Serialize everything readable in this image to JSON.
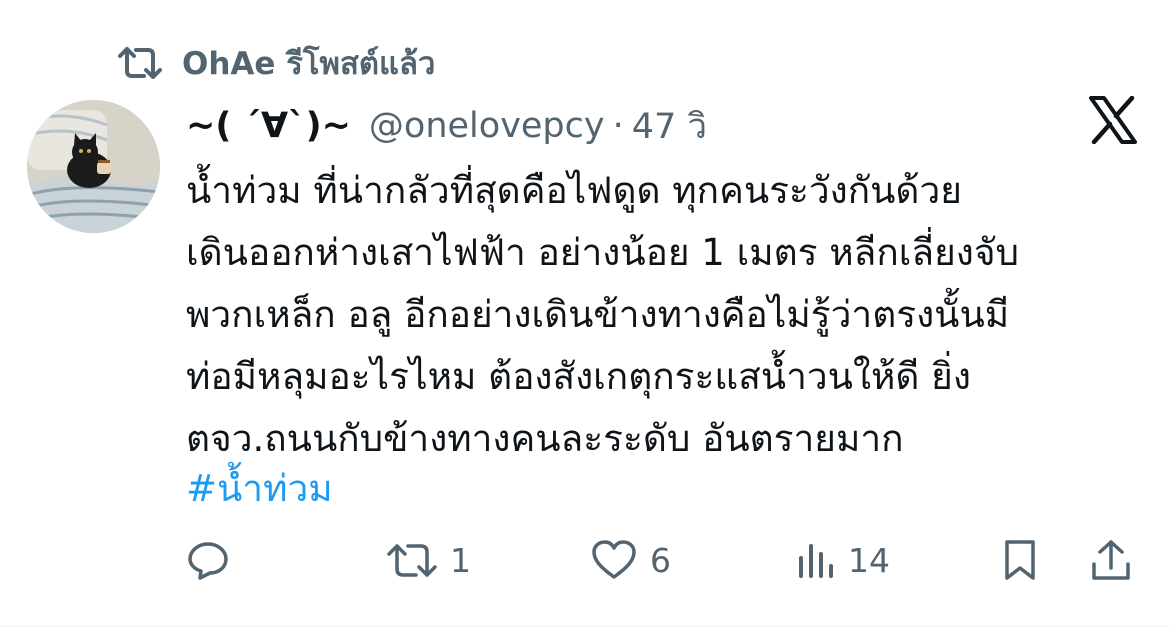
{
  "repost": {
    "icon": "repost-icon",
    "text": "OhAe รีโพสต์แล้ว"
  },
  "author": {
    "display_name": "~( ´∀`)~",
    "handle": "@onelovepcy",
    "separator": "·",
    "time": "47 วิ",
    "avatar": "cat-in-bed-avatar"
  },
  "platform_logo": "x-logo-icon",
  "tweet": {
    "lines": [
      "น้ำท่วม ที่น่ากลัวที่สุดคือไฟดูด ทุกคนระวังกันด้วย",
      "เดินออกห่างเสาไฟฟ้า อย่างน้อย 1 เมตร หลีกเลี่ยงจับ",
      "พวกเหล็ก อลู อีกอย่างเดินข้างทางคือไม่รู้ว่าตรงนั้นมี",
      "ท่อมีหลุมอะไรไหม ต้องสังเกตุกระแสน้ำวนให้ดี  ยิ่ง",
      "ตจว.ถนนกับข้างทางคนละระดับ อันตรายมาก"
    ],
    "hashtag": "#น้ำท่วม"
  },
  "actions": {
    "reply": {
      "icon": "reply-icon",
      "count": ""
    },
    "repost": {
      "icon": "repost-icon",
      "count": "1"
    },
    "like": {
      "icon": "heart-icon",
      "count": "6"
    },
    "views": {
      "icon": "views-chart-icon",
      "count": "14"
    },
    "bookmark": {
      "icon": "bookmark-icon",
      "count": ""
    },
    "share": {
      "icon": "share-icon",
      "count": ""
    }
  },
  "colors": {
    "text": "#0f1419",
    "secondary": "#536471",
    "link": "#1d9bf0"
  }
}
